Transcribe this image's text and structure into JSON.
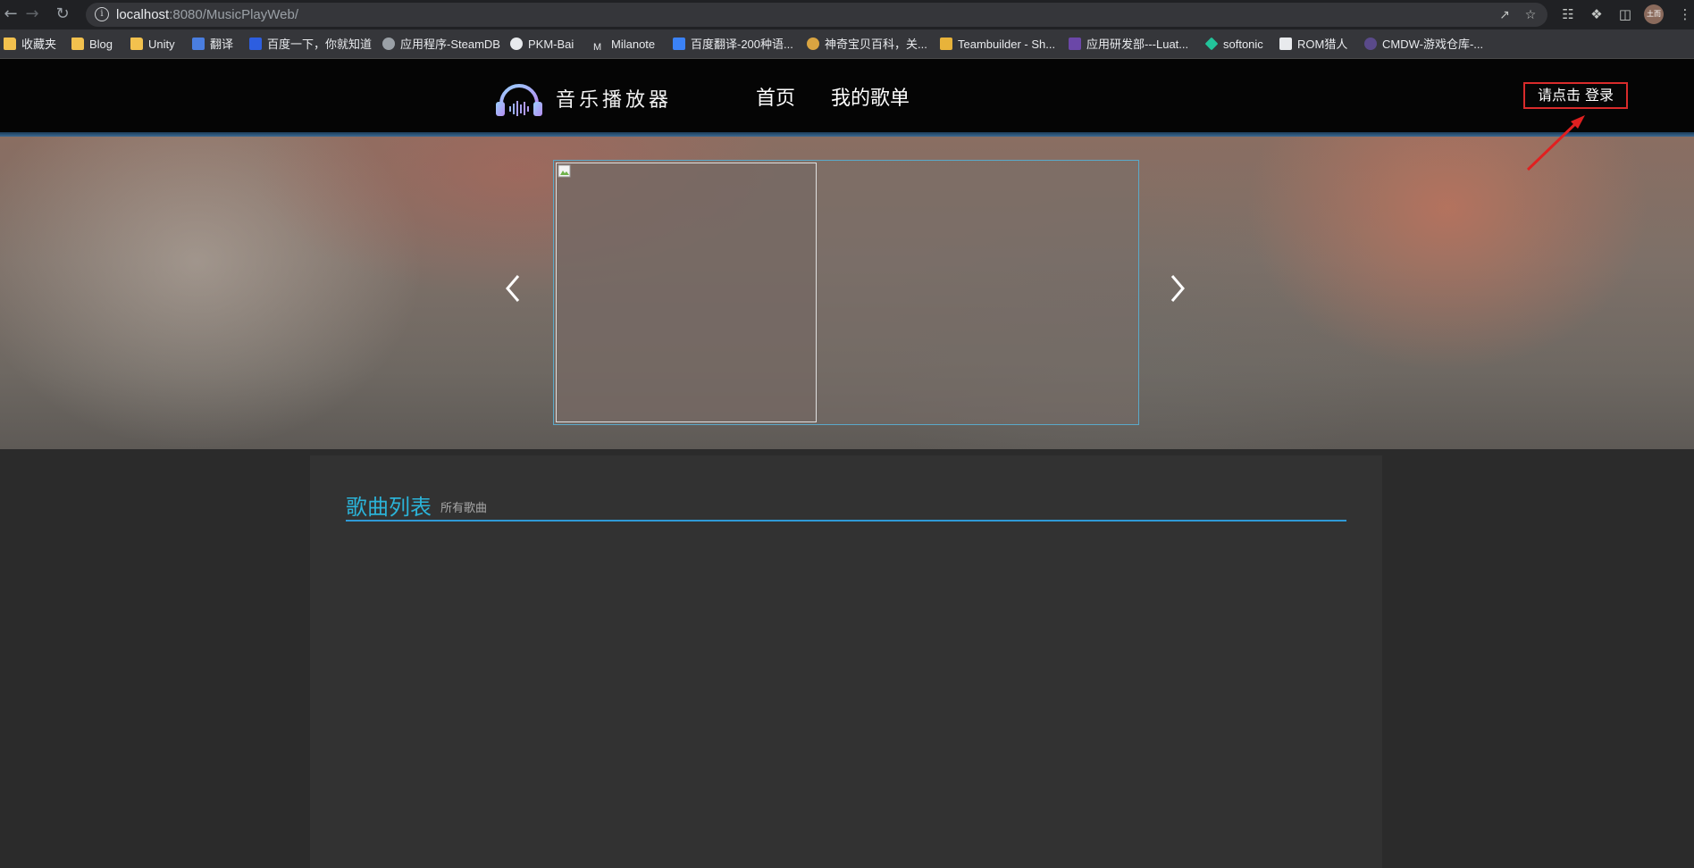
{
  "browser": {
    "url_host": "localhost",
    "url_rest": ":8080/MusicPlayWeb/",
    "avatar_text": "土而",
    "bookmarks": [
      {
        "label": "收藏夹",
        "icon": "folder-icon"
      },
      {
        "label": "Blog",
        "icon": "folder-icon"
      },
      {
        "label": "Unity",
        "icon": "folder-icon"
      },
      {
        "label": "翻译",
        "icon": "translate-icon"
      },
      {
        "label": "百度一下，你就知道",
        "icon": "baidu-icon"
      },
      {
        "label": "应用程序-SteamDB",
        "icon": "steamdb-icon"
      },
      {
        "label": "PKM-Bai",
        "icon": "github-icon"
      },
      {
        "label": "Milanote",
        "icon": "milanote-icon"
      },
      {
        "label": "百度翻译-200种语...",
        "icon": "baidu-translate-icon"
      },
      {
        "label": "神奇宝贝百科，关...",
        "icon": "pokemon-icon"
      },
      {
        "label": "Teambuilder - Sh...",
        "icon": "showdown-icon"
      },
      {
        "label": "应用研发部---Luat...",
        "icon": "luat-icon"
      },
      {
        "label": "softonic",
        "icon": "softonic-icon"
      },
      {
        "label": "ROM猎人",
        "icon": "rom-icon"
      },
      {
        "label": "CMDW-游戏仓库-...",
        "icon": "cmdw-icon"
      }
    ]
  },
  "header": {
    "logo_text": "音乐播放器",
    "nav": [
      "首页",
      "我的歌单"
    ],
    "login_label": "请点击 登录"
  },
  "annotation": {
    "color": "#e02020"
  },
  "main": {
    "section_title": "歌曲列表",
    "section_subtitle": "所有歌曲"
  },
  "colors": {
    "accent": "#2bb3d8",
    "login_border": "#d92b2b",
    "header_bg": "#050505"
  }
}
